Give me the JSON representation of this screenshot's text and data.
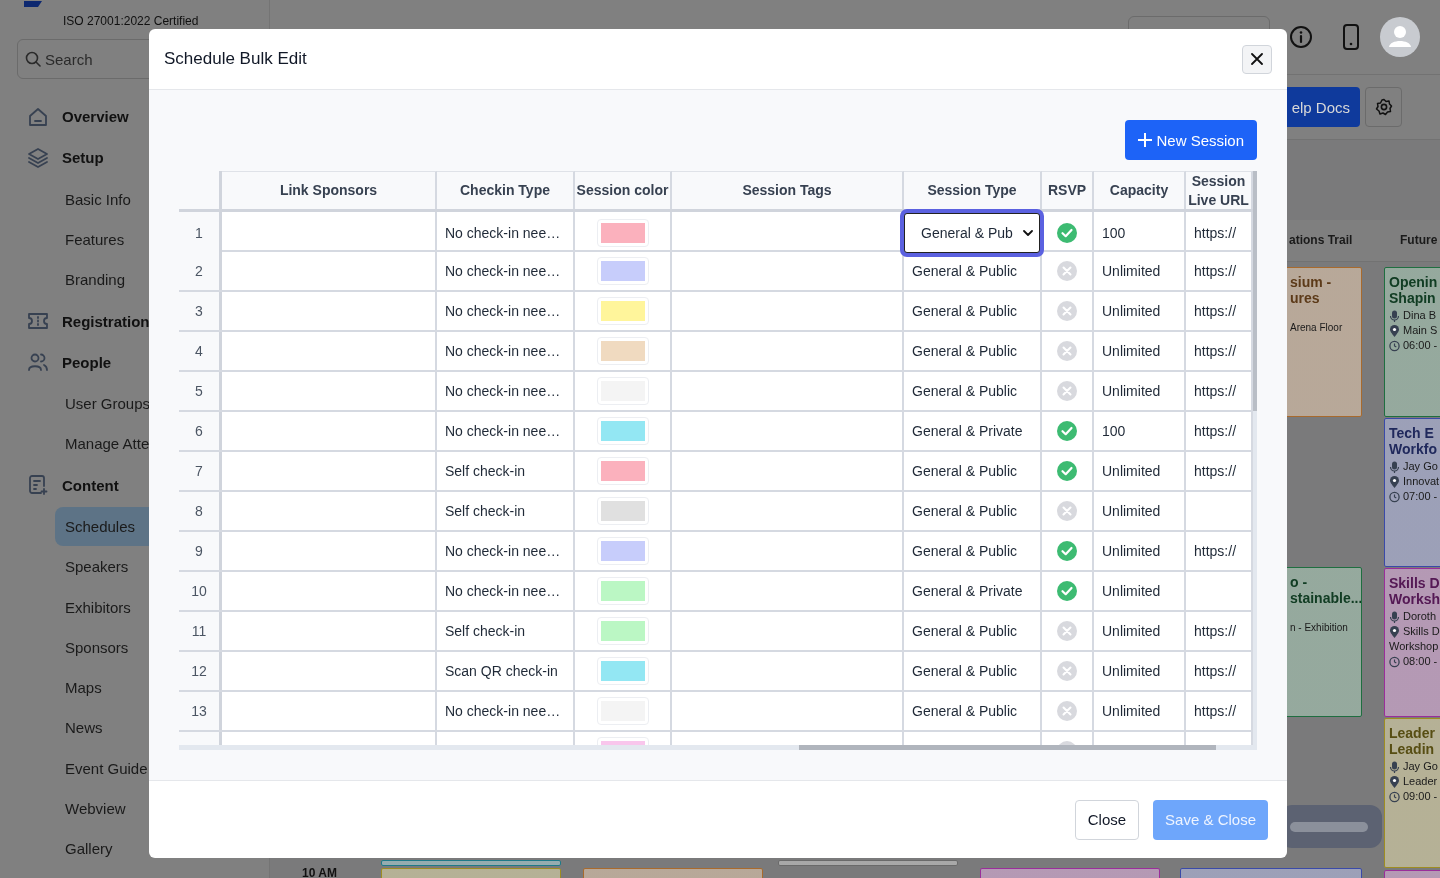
{
  "sidebar": {
    "certification": "ISO 27001:2022 Certified",
    "search": {
      "placeholder": "Search"
    },
    "items": [
      {
        "label": "Overview",
        "selected": false
      },
      {
        "label": "Setup",
        "selected": false,
        "children": [
          {
            "label": "Basic Info",
            "selected": false
          },
          {
            "label": "Features",
            "selected": false
          },
          {
            "label": "Branding",
            "selected": false
          }
        ]
      },
      {
        "label": "Registration",
        "selected": false
      },
      {
        "label": "People",
        "selected": false,
        "children": [
          {
            "label": "User Groups",
            "selected": false
          },
          {
            "label": "Manage Atte",
            "selected": false
          }
        ]
      },
      {
        "label": "Content",
        "selected": false,
        "children": [
          {
            "label": "Schedules",
            "selected": true
          },
          {
            "label": "Speakers",
            "selected": false
          },
          {
            "label": "Exhibitors",
            "selected": false
          },
          {
            "label": "Sponsors",
            "selected": false
          },
          {
            "label": "Maps",
            "selected": false
          },
          {
            "label": "News",
            "selected": false
          },
          {
            "label": "Event Guide",
            "selected": false
          },
          {
            "label": "Webview",
            "selected": false
          },
          {
            "label": "Gallery",
            "selected": false
          }
        ]
      }
    ]
  },
  "toolbar": {
    "help_button": "elp Docs"
  },
  "calendar": {
    "columns": [
      "ations Trail",
      "Future"
    ],
    "time_labels": [
      "10 AM"
    ],
    "cards": [
      {
        "title": "sium -\nures",
        "color": "#a86a2d",
        "details": [
          {
            "kind": "text",
            "text": "Arena Floor"
          }
        ]
      },
      {
        "title": "Openin\nShapin",
        "color": "#1f6e40",
        "details": [
          {
            "kind": "speaker",
            "text": "Dina B"
          },
          {
            "kind": "location",
            "text": "Main S"
          },
          {
            "kind": "time",
            "text": "06:00 -"
          }
        ]
      },
      {
        "title": "Tech E\nWorkfo",
        "color": "#3a4aa8",
        "details": [
          {
            "kind": "speaker",
            "text": "Jay Go"
          },
          {
            "kind": "location",
            "text": "Innovat"
          },
          {
            "kind": "time",
            "text": "07:00 -"
          }
        ]
      },
      {
        "title": "o -\nstainable...",
        "color": "#1f6e40",
        "details": [
          {
            "kind": "text",
            "text": "n - Exhibition"
          }
        ]
      },
      {
        "title": "Skills D\nWorksh",
        "color": "#9a2e9a",
        "details": [
          {
            "kind": "speaker",
            "text": "Doroth"
          },
          {
            "kind": "location",
            "text": "Skills D"
          },
          {
            "kind": "continued",
            "text": "Workshop"
          },
          {
            "kind": "time",
            "text": "08:00 -"
          }
        ]
      },
      {
        "title": "Leader\nLeadin",
        "color": "#9e8d22",
        "details": [
          {
            "kind": "speaker",
            "text": "Jay Go"
          },
          {
            "kind": "location",
            "text": "Leader"
          },
          {
            "kind": "time",
            "text": "09:00 -"
          }
        ]
      },
      {
        "color": "#1f7a88"
      },
      {
        "color": "#9e8d22"
      },
      {
        "color": "#a86a2d"
      },
      {
        "color": "#6a6a6a"
      },
      {
        "color": "#9a2e9a"
      },
      {
        "color": "#3a4aa8"
      },
      {
        "color": "#9a2e9a"
      }
    ]
  },
  "modal": {
    "title": "Schedule Bulk Edit",
    "new_session_button": "New Session",
    "table": {
      "columns": [
        "Link Sponsors",
        "Checkin Type",
        "Session color",
        "Session Tags",
        "Session Type",
        "RSVP",
        "Capacity",
        "Session Live URL"
      ],
      "rows": [
        {
          "number": "1",
          "checkin_type": "No check-in nee…",
          "color": "#fbb1bd",
          "session_type": "General & Pub",
          "editing": true,
          "rsvp": true,
          "capacity": "100",
          "live_url": "https://"
        },
        {
          "number": "2",
          "checkin_type": "No check-in nee…",
          "color": "#c7cdfb",
          "session_type": "General & Public",
          "editing": false,
          "rsvp": false,
          "capacity": "Unlimited",
          "live_url": "https://"
        },
        {
          "number": "3",
          "checkin_type": "No check-in nee…",
          "color": "#fff59b",
          "session_type": "General & Public",
          "editing": false,
          "rsvp": false,
          "capacity": "Unlimited",
          "live_url": "https://"
        },
        {
          "number": "4",
          "checkin_type": "No check-in nee…",
          "color": "#f0dac0",
          "session_type": "General & Public",
          "editing": false,
          "rsvp": false,
          "capacity": "Unlimited",
          "live_url": "https://"
        },
        {
          "number": "5",
          "checkin_type": "No check-in nee…",
          "color": "#f4f4f4",
          "session_type": "General & Public",
          "editing": false,
          "rsvp": false,
          "capacity": "Unlimited",
          "live_url": "https://"
        },
        {
          "number": "6",
          "checkin_type": "No check-in nee…",
          "color": "#93e7f3",
          "session_type": "General & Private",
          "editing": false,
          "rsvp": true,
          "capacity": "100",
          "live_url": "https://"
        },
        {
          "number": "7",
          "checkin_type": "Self check-in",
          "color": "#fbb1bd",
          "session_type": "General & Public",
          "editing": false,
          "rsvp": true,
          "capacity": "Unlimited",
          "live_url": "https://"
        },
        {
          "number": "8",
          "checkin_type": "Self check-in",
          "color": "#e0e0e0",
          "session_type": "General & Public",
          "editing": false,
          "rsvp": false,
          "capacity": "Unlimited"
        },
        {
          "number": "9",
          "checkin_type": "No check-in nee…",
          "color": "#c7cdfb",
          "session_type": "General & Public",
          "editing": false,
          "rsvp": true,
          "capacity": "Unlimited",
          "live_url": "https://"
        },
        {
          "number": "10",
          "checkin_type": "No check-in nee…",
          "color": "#bbf7c4",
          "session_type": "General & Private",
          "editing": false,
          "rsvp": true,
          "capacity": "Unlimited"
        },
        {
          "number": "11",
          "checkin_type": "Self check-in",
          "color": "#bbf7c4",
          "session_type": "General & Public",
          "editing": false,
          "rsvp": false,
          "capacity": "Unlimited",
          "live_url": "https://"
        },
        {
          "number": "12",
          "checkin_type": "Scan QR check-in",
          "color": "#93e7f3",
          "session_type": "General & Public",
          "editing": false,
          "rsvp": false,
          "capacity": "Unlimited",
          "live_url": "https://"
        },
        {
          "number": "13",
          "checkin_type": "No check-in nee…",
          "color": "#f4f4f4",
          "session_type": "General & Public",
          "editing": false,
          "rsvp": false,
          "capacity": "Unlimited",
          "live_url": "https://"
        },
        {
          "color": "#f9c6ec",
          "editing": false,
          "rsvp": false
        }
      ]
    },
    "buttons": [
      {
        "label": "Close",
        "kind": "secondary",
        "disabled": false
      },
      {
        "label": "Save & Close",
        "kind": "primary",
        "disabled": true
      }
    ]
  }
}
